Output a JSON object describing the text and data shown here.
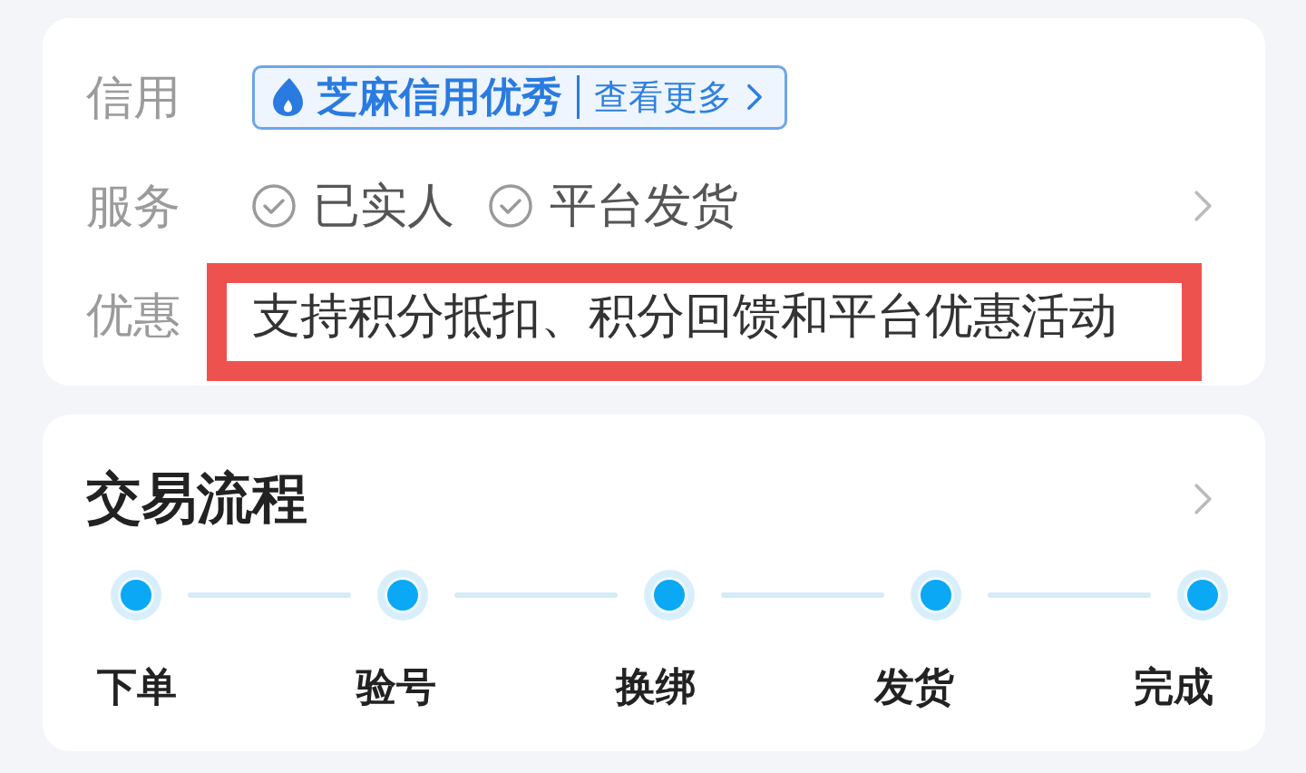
{
  "info_card": {
    "rows": [
      {
        "kind": "badge",
        "label": "信用",
        "badge": {
          "title": "芝麻信用优秀",
          "link": "查看更多"
        }
      },
      {
        "kind": "tags",
        "label": "服务",
        "tags": [
          "已实人",
          "平台发货"
        ]
      },
      {
        "kind": "text",
        "label": "优惠",
        "text": "支持积分抵扣、积分回馈和平台优惠活动",
        "highlighted": true
      }
    ]
  },
  "process_card": {
    "title": "交易流程",
    "steps": [
      "下单",
      "验号",
      "换绑",
      "发货",
      "完成"
    ]
  }
}
